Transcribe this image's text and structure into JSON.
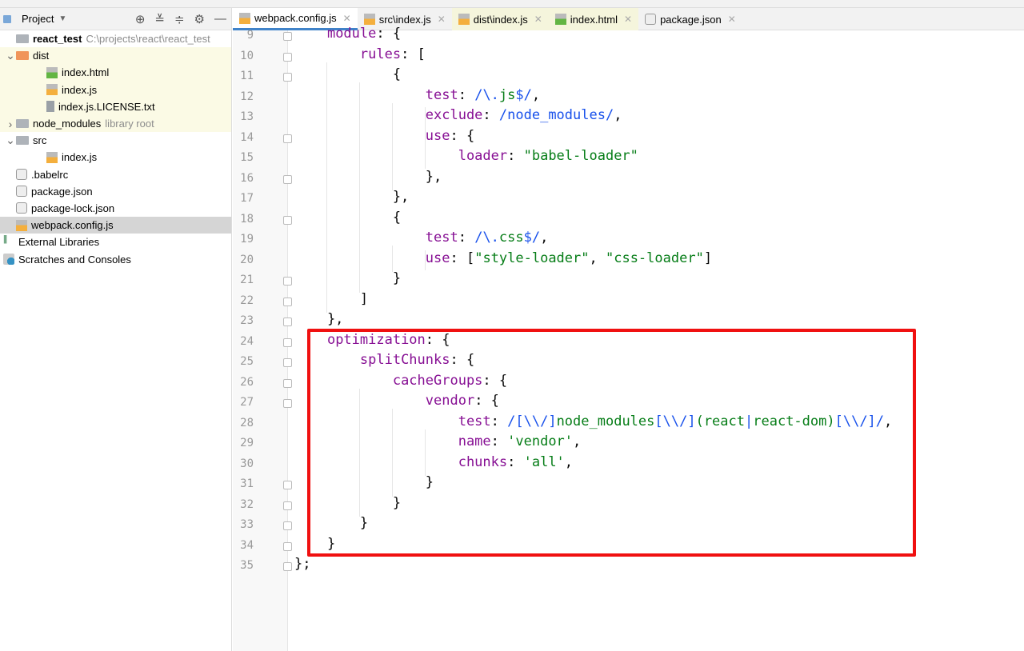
{
  "project_panel": {
    "title": "Project",
    "tools": [
      "locate-icon",
      "expand-all-icon",
      "collapse-all-icon",
      "gear-icon",
      "minimize-icon"
    ],
    "tree": [
      {
        "label": "react_test",
        "hint": "C:\\projects\\react\\react_test",
        "icon": "folder",
        "depth": 0,
        "bold": true
      },
      {
        "label": "dist",
        "icon": "folder-orange",
        "depth": 0,
        "arrow": "open",
        "hl": true
      },
      {
        "label": "index.html",
        "icon": "html",
        "depth": 1,
        "hl": true
      },
      {
        "label": "index.js",
        "icon": "js",
        "depth": 1,
        "hl": true
      },
      {
        "label": "index.js.LICENSE.txt",
        "icon": "txt",
        "depth": 1,
        "hl": true
      },
      {
        "label": "node_modules",
        "hint": "library root",
        "icon": "folder",
        "depth": 0,
        "arrow": "closed",
        "hl": true
      },
      {
        "label": "src",
        "icon": "folder",
        "depth": 0,
        "arrow": "open"
      },
      {
        "label": "index.js",
        "icon": "js",
        "depth": 1
      },
      {
        "label": ".babelrc",
        "icon": "json",
        "depth": 0
      },
      {
        "label": "package.json",
        "icon": "json",
        "depth": 0
      },
      {
        "label": "package-lock.json",
        "icon": "json",
        "depth": 0
      },
      {
        "label": "webpack.config.js",
        "icon": "js",
        "depth": 0,
        "selected": true
      },
      {
        "label": "External Libraries",
        "icon": "libraries",
        "depth": -1
      },
      {
        "label": "Scratches and Consoles",
        "icon": "scratches",
        "depth": -1
      }
    ]
  },
  "tabs": [
    {
      "label": "webpack.config.js",
      "icon": "js",
      "active": true
    },
    {
      "label": "src\\index.js",
      "icon": "js"
    },
    {
      "label": "dist\\index.js",
      "icon": "js",
      "dist": true
    },
    {
      "label": "index.html",
      "icon": "html",
      "dist": true
    },
    {
      "label": "package.json",
      "icon": "json"
    }
  ],
  "editor": {
    "first_line": 9,
    "highlight_color": "#f01010",
    "lines": [
      [
        [
          "",
          "    "
        ],
        [
          "k",
          "module"
        ],
        [
          "",
          ": {"
        ]
      ],
      [
        [
          "",
          "        "
        ],
        [
          "k",
          "rules"
        ],
        [
          "",
          ": ["
        ]
      ],
      [
        [
          "",
          "            {"
        ]
      ],
      [
        [
          "",
          "                "
        ],
        [
          "k",
          "test"
        ],
        [
          "",
          ": "
        ],
        [
          "r",
          "/\\."
        ],
        [
          "s",
          "js"
        ],
        [
          "r",
          "$/"
        ],
        [
          "",
          ","
        ]
      ],
      [
        [
          "",
          "                "
        ],
        [
          "k",
          "exclude"
        ],
        [
          "",
          ": "
        ],
        [
          "r",
          "/node_modules/"
        ],
        [
          "",
          ","
        ]
      ],
      [
        [
          "",
          "                "
        ],
        [
          "k",
          "use"
        ],
        [
          "",
          ": {"
        ]
      ],
      [
        [
          "",
          "                    "
        ],
        [
          "k",
          "loader"
        ],
        [
          "",
          ": "
        ],
        [
          "s",
          "\"babel-loader\""
        ]
      ],
      [
        [
          "",
          "                },"
        ]
      ],
      [
        [
          "",
          "            },"
        ]
      ],
      [
        [
          "",
          "            {"
        ]
      ],
      [
        [
          "",
          "                "
        ],
        [
          "k",
          "test"
        ],
        [
          "",
          ": "
        ],
        [
          "r",
          "/\\."
        ],
        [
          "s",
          "css"
        ],
        [
          "r",
          "$/"
        ],
        [
          "",
          ","
        ]
      ],
      [
        [
          "",
          "                "
        ],
        [
          "k",
          "use"
        ],
        [
          "",
          ": ["
        ],
        [
          "s",
          "\"style-loader\""
        ],
        [
          "",
          ", "
        ],
        [
          "s",
          "\"css-loader\""
        ],
        [
          "",
          "]"
        ]
      ],
      [
        [
          "",
          "            }"
        ]
      ],
      [
        [
          "",
          "        ]"
        ]
      ],
      [
        [
          "",
          "    },"
        ]
      ],
      [
        [
          "",
          "    "
        ],
        [
          "k",
          "optimization"
        ],
        [
          "",
          ": {"
        ]
      ],
      [
        [
          "",
          "        "
        ],
        [
          "k",
          "splitChunks"
        ],
        [
          "",
          ": {"
        ]
      ],
      [
        [
          "",
          "            "
        ],
        [
          "k",
          "cacheGroups"
        ],
        [
          "",
          ": {"
        ]
      ],
      [
        [
          "",
          "                "
        ],
        [
          "k",
          "vendor"
        ],
        [
          "",
          ": {"
        ]
      ],
      [
        [
          "",
          "                    "
        ],
        [
          "k",
          "test"
        ],
        [
          "",
          ": "
        ],
        [
          "r",
          "/[\\\\/]"
        ],
        [
          "s",
          "node_modules"
        ],
        [
          "r",
          "[\\\\/]"
        ],
        [
          "s",
          "(react"
        ],
        [
          "r",
          "|"
        ],
        [
          "s",
          "react-dom)"
        ],
        [
          "r",
          "[\\\\/]/"
        ],
        [
          "",
          ","
        ]
      ],
      [
        [
          "",
          "                    "
        ],
        [
          "k",
          "name"
        ],
        [
          "",
          ": "
        ],
        [
          "s",
          "'vendor'"
        ],
        [
          "",
          ","
        ]
      ],
      [
        [
          "",
          "                    "
        ],
        [
          "k",
          "chunks"
        ],
        [
          "",
          ": "
        ],
        [
          "s",
          "'all'"
        ],
        [
          "",
          ","
        ]
      ],
      [
        [
          "",
          "                }"
        ]
      ],
      [
        [
          "",
          "            }"
        ]
      ],
      [
        [
          "",
          "        }"
        ]
      ],
      [
        [
          "",
          "    }"
        ]
      ],
      [
        [
          "",
          "};"
        ]
      ]
    ]
  }
}
